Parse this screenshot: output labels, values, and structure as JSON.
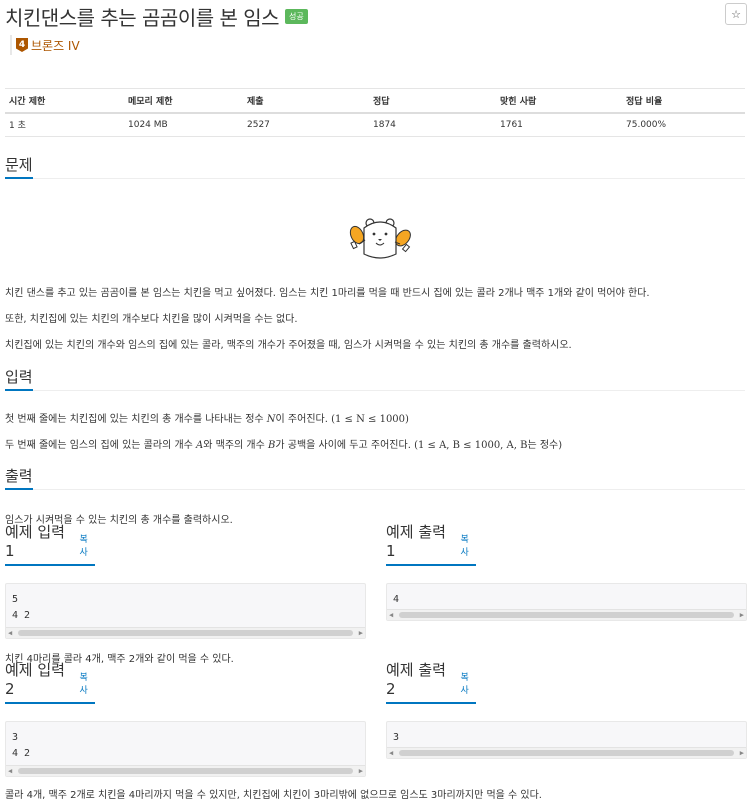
{
  "problem": {
    "title": "치킨댄스를 추는 곰곰이를 본 임스",
    "status_badge": "성공",
    "star_icon": "☆",
    "tier": {
      "number": "4",
      "label": "브론즈 IV",
      "color": "#ad5600"
    }
  },
  "stats": {
    "headers": [
      "시간 제한",
      "메모리 제한",
      "제출",
      "정답",
      "맞힌 사람",
      "정답 비율"
    ],
    "values": [
      "1 초",
      "1024 MB",
      "2527",
      "1874",
      "1761",
      "75.000%"
    ]
  },
  "sections": {
    "problem_heading": "문제",
    "problem_paragraphs": [
      "치킨 댄스를 추고 있는 곰곰이를 본 임스는 치킨을 먹고 싶어졌다. 임스는 치킨 1마리를 먹을 때 반드시 집에 있는 콜라 2개나 맥주 1개와 같이 먹어야 한다.",
      "또한, 치킨집에 있는 치킨의 개수보다 치킨을 많이 시켜먹을 수는 없다.",
      "치킨집에 있는 치킨의 개수와 임스의 집에 있는 콜라, 맥주의 개수가 주어졌을 때, 임스가 시켜먹을 수 있는 치킨의 총 개수를 출력하시오."
    ],
    "input_heading": "입력",
    "input_line1": {
      "before": "첫 번째 줄에는 치킨집에 있는 치킨의 총 개수를 나타내는 정수 ",
      "var": "N",
      "after": "이 주어진다. ",
      "constraint": "(1 ≤ N ≤ 1000)"
    },
    "input_line2": {
      "a": "두 번째 줄에는 임스의 집에 있는 콜라의 개수 ",
      "var_a": "A",
      "b": "와 맥주의 개수 ",
      "var_b": "B",
      "c": "가 공백을 사이에 두고 주어진다. ",
      "constraint": "(1 ≤ A, B ≤ 1000, A, B",
      "d": "는 정수)"
    },
    "output_heading": "출력",
    "output_text": "임스가 시켜먹을 수 있는 치킨의 총 개수를 출력하시오."
  },
  "samples": [
    {
      "input_heading": "예제 입력 1",
      "output_heading": "예제 출력 1",
      "copy_label": "복사",
      "input": "5\n4 2",
      "output": "4",
      "note": "치킨 4마리를 콜라 4개, 맥주 2개와 같이 먹을 수 있다."
    },
    {
      "input_heading": "예제 입력 2",
      "output_heading": "예제 출력 2",
      "copy_label": "복사",
      "input": "3\n4 2",
      "output": "3",
      "note": "콜라 4개, 맥주 2개로 치킨을 4마리까지 먹을 수 있지만, 치킨집에 치킨이 3마리밖에 없으므로 임스도 3마리까지만 먹을 수 있다."
    }
  ],
  "scroll_arrows": {
    "left": "◀",
    "right": "▶"
  }
}
